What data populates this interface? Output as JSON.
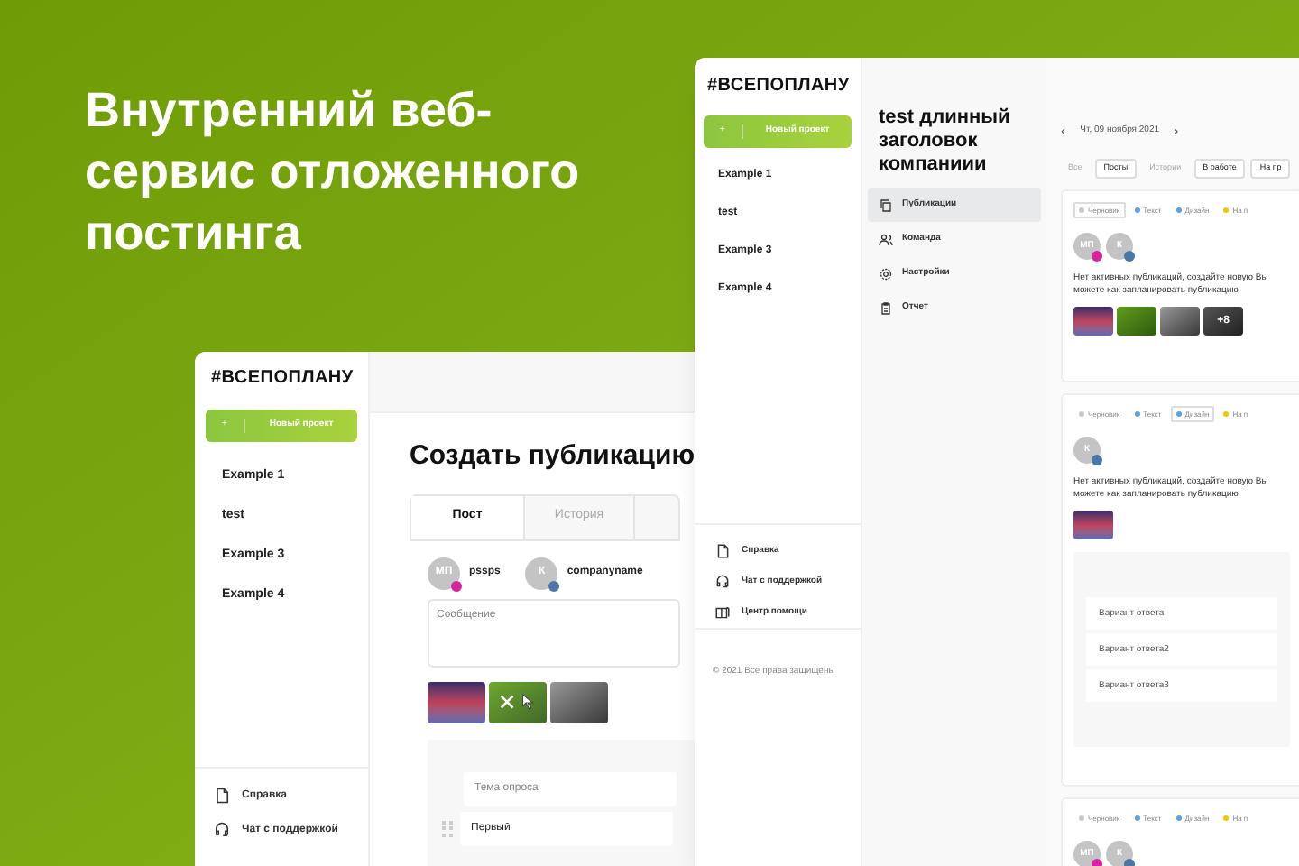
{
  "headline": "Внутренний веб-сервис отложенного постинга",
  "back_window": {
    "logo": "#ВСЕПОПЛАНУ",
    "new_project": {
      "icon": "+",
      "label": "Новый проект"
    },
    "projects": [
      {
        "label": "Example 1"
      },
      {
        "label": "test"
      },
      {
        "label": "Example 3"
      },
      {
        "label": "Example 4"
      }
    ],
    "help_links": [
      {
        "label": "Справка"
      },
      {
        "label": "Чат с поддержкой"
      },
      {
        "label": "Центр помощи"
      }
    ],
    "copyright": "© 2021 Все права защищены",
    "company_title": "test длинный заголовок компаниии",
    "nav": [
      {
        "label": "Публикации",
        "selected": true
      },
      {
        "label": "Команда",
        "selected": false
      },
      {
        "label": "Настройки",
        "selected": false
      },
      {
        "label": "Отчет",
        "selected": false
      }
    ],
    "date": {
      "prev": "‹",
      "label": "Чт, 09 ноября 2021",
      "next": "›"
    },
    "filters": [
      {
        "label": "Все",
        "selected": false
      },
      {
        "label": "Посты",
        "selected": true
      },
      {
        "label": "Истории",
        "selected": false
      },
      {
        "label": "В работе",
        "selected": true
      },
      {
        "label": "На пр",
        "selected": true
      }
    ],
    "posts": [
      {
        "tags": [
          {
            "label": "Черновик",
            "color": "#c8c8c8",
            "selected": true
          },
          {
            "label": "Текст",
            "color": "#5aa0e6",
            "selected": false
          },
          {
            "label": "Дизайн",
            "color": "#5aa0e6",
            "selected": false
          },
          {
            "label": "На п",
            "color": "#f0c800",
            "selected": false
          }
        ],
        "accounts": [
          {
            "initials": "МП",
            "color": "#d6249f"
          },
          {
            "initials": "К",
            "color": "#4a76a8"
          }
        ],
        "message": "Нет активных публикаций, создайте новую Вы можете как запланировать публикацию",
        "images": [
          {
            "kind": "photo"
          },
          {
            "kind": "photo"
          },
          {
            "kind": "photo"
          },
          {
            "kind": "more",
            "label": "+8"
          }
        ]
      },
      {
        "tags": [
          {
            "label": "Черновик",
            "color": "#c8c8c8",
            "selected": false
          },
          {
            "label": "Текст",
            "color": "#5aa0e6",
            "selected": false
          },
          {
            "label": "Дизайн",
            "color": "#5aa0e6",
            "selected": true
          },
          {
            "label": "На п",
            "color": "#f0c800",
            "selected": false
          }
        ],
        "accounts": [
          {
            "initials": "К",
            "color": "#4a76a8"
          }
        ],
        "message": "Нет активных публикаций, создайте новую Вы можете как запланировать публикацию",
        "images": [
          {
            "kind": "photo"
          }
        ],
        "poll_options": [
          "Вариант ответа",
          "Вариант ответа2",
          "Вариант ответа3"
        ]
      },
      {
        "tags": [
          {
            "label": "Черновик",
            "color": "#c8c8c8",
            "selected": false
          },
          {
            "label": "Текст",
            "color": "#5aa0e6",
            "selected": false
          },
          {
            "label": "Дизайн",
            "color": "#5aa0e6",
            "selected": false
          },
          {
            "label": "На п",
            "color": "#f0c800",
            "selected": false
          }
        ],
        "accounts": [
          {
            "initials": "МП",
            "color": "#d6249f"
          },
          {
            "initials": "К",
            "color": "#4a76a8"
          }
        ]
      }
    ]
  },
  "front_window": {
    "logo": "#ВСЕПОПЛАНУ",
    "new_project": {
      "icon": "+",
      "label": "Новый проект"
    },
    "projects": [
      {
        "label": "Example 1"
      },
      {
        "label": "test"
      },
      {
        "label": "Example 3"
      },
      {
        "label": "Example 4"
      }
    ],
    "help_links": [
      {
        "label": "Справка"
      },
      {
        "label": "Чат с поддержкой"
      }
    ],
    "title": "Создать публикацию",
    "tabs": [
      {
        "label": "Пост",
        "selected": true
      },
      {
        "label": "История",
        "selected": false
      }
    ],
    "accounts": [
      {
        "initials": "МП",
        "name": "pssps",
        "color": "#d6249f"
      },
      {
        "initials": "К",
        "name": "companyname",
        "color": "#4a76a8"
      }
    ],
    "message": {
      "placeholder": "Сообщение"
    },
    "images": [
      {
        "kind": "photo"
      },
      {
        "kind": "removing"
      },
      {
        "kind": "photo"
      }
    ],
    "poll": {
      "topic": {
        "placeholder": "Тема опроса"
      },
      "option": {
        "value": "Первый"
      }
    }
  }
}
